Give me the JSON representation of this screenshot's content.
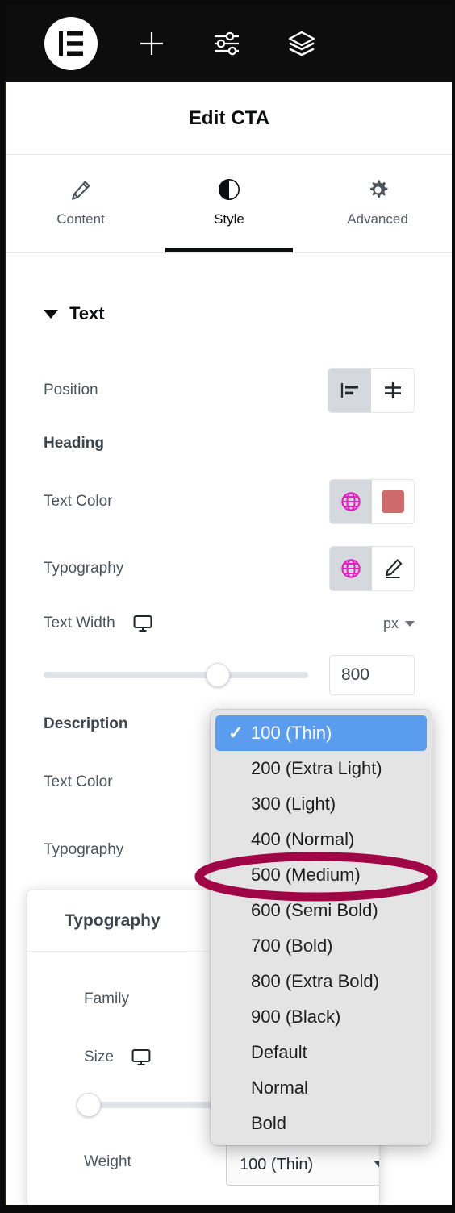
{
  "toolbar": {
    "logo": "elementor-logo",
    "buttons": [
      {
        "name": "add-element-button",
        "icon": "plus-icon"
      },
      {
        "name": "settings-button",
        "icon": "sliders-icon"
      },
      {
        "name": "navigator-button",
        "icon": "layers-icon"
      }
    ]
  },
  "panel": {
    "title": "Edit CTA",
    "tabs": [
      {
        "label": "Content",
        "icon": "pencil-icon",
        "active": false
      },
      {
        "label": "Style",
        "icon": "contrast-icon",
        "active": true
      },
      {
        "label": "Advanced",
        "icon": "gear-icon",
        "active": false
      }
    ]
  },
  "style_tab": {
    "section": {
      "label": "Text",
      "expanded": true
    },
    "position": {
      "label": "Position",
      "options": [
        {
          "name": "align-left",
          "icon": "align-left-icon",
          "active": true
        },
        {
          "name": "align-middle",
          "icon": "align-middle-icon",
          "active": false
        }
      ]
    },
    "heading_group": {
      "label": "Heading",
      "text_color": {
        "label": "Text Color",
        "global_icon": "globe-icon",
        "swatch_color": "#d06a6a"
      },
      "typography": {
        "label": "Typography",
        "global_icon": "globe-icon",
        "edit_icon": "pencil-edit-icon"
      },
      "text_width": {
        "label": "Text Width",
        "device_icon": "desktop-icon",
        "unit": "px",
        "value": "800",
        "slider_percent": 66
      }
    },
    "description_group": {
      "label": "Description",
      "text_color": {
        "label": "Text Color"
      },
      "typography": {
        "label": "Typography"
      }
    }
  },
  "typography_popover": {
    "title": "Typography",
    "family": {
      "label": "Family"
    },
    "size": {
      "label": "Size",
      "device_icon": "desktop-icon",
      "slider_percent": 2
    },
    "weight": {
      "label": "Weight",
      "value": "100 (Thin)"
    }
  },
  "weight_dropdown": {
    "open": true,
    "selected": "100 (Thin)",
    "highlight_color": "#5a9ced",
    "options": [
      {
        "label": "100 (Thin)",
        "selected": true
      },
      {
        "label": "200 (Extra Light)",
        "selected": false
      },
      {
        "label": "300 (Light)",
        "selected": false
      },
      {
        "label": "400 (Normal)",
        "selected": false
      },
      {
        "label": "500 (Medium)",
        "selected": false
      },
      {
        "label": "600 (Semi Bold)",
        "selected": false
      },
      {
        "label": "700 (Bold)",
        "selected": false
      },
      {
        "label": "800 (Extra Bold)",
        "selected": false
      },
      {
        "label": "900 (Black)",
        "selected": false
      },
      {
        "label": "Default",
        "selected": false
      },
      {
        "label": "Normal",
        "selected": false
      },
      {
        "label": "Bold",
        "selected": false
      }
    ]
  },
  "annotation": {
    "shape": "ellipse",
    "color": "#a00545",
    "targets": "500 (Medium)"
  }
}
